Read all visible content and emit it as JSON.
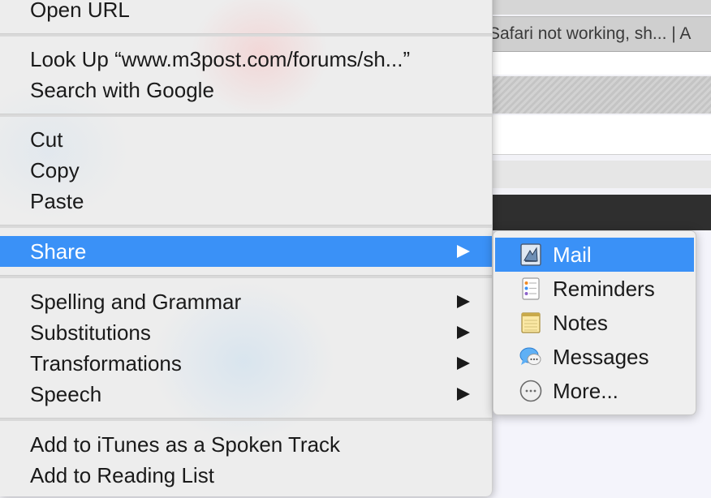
{
  "background": {
    "tab_title": "Safari not working, sh... | A"
  },
  "context_menu": {
    "items": [
      {
        "label": "Open URL"
      },
      {
        "label": "Look Up “www.m3post.com/forums/sh...”"
      },
      {
        "label": "Search with Google"
      },
      {
        "label": "Cut"
      },
      {
        "label": "Copy"
      },
      {
        "label": "Paste"
      },
      {
        "label": "Share"
      },
      {
        "label": "Spelling and Grammar"
      },
      {
        "label": "Substitutions"
      },
      {
        "label": "Transformations"
      },
      {
        "label": "Speech"
      },
      {
        "label": "Add to iTunes as a Spoken Track"
      },
      {
        "label": "Add to Reading List"
      }
    ],
    "highlighted": "Share"
  },
  "share_submenu": {
    "items": [
      {
        "label": "Mail",
        "icon": "mail-icon"
      },
      {
        "label": "Reminders",
        "icon": "reminders-icon"
      },
      {
        "label": "Notes",
        "icon": "notes-icon"
      },
      {
        "label": "Messages",
        "icon": "messages-icon"
      },
      {
        "label": "More...",
        "icon": "more-icon"
      }
    ],
    "highlighted": "Mail"
  },
  "colors": {
    "highlight": "#3a91f7",
    "menu_background": "#ededed"
  }
}
